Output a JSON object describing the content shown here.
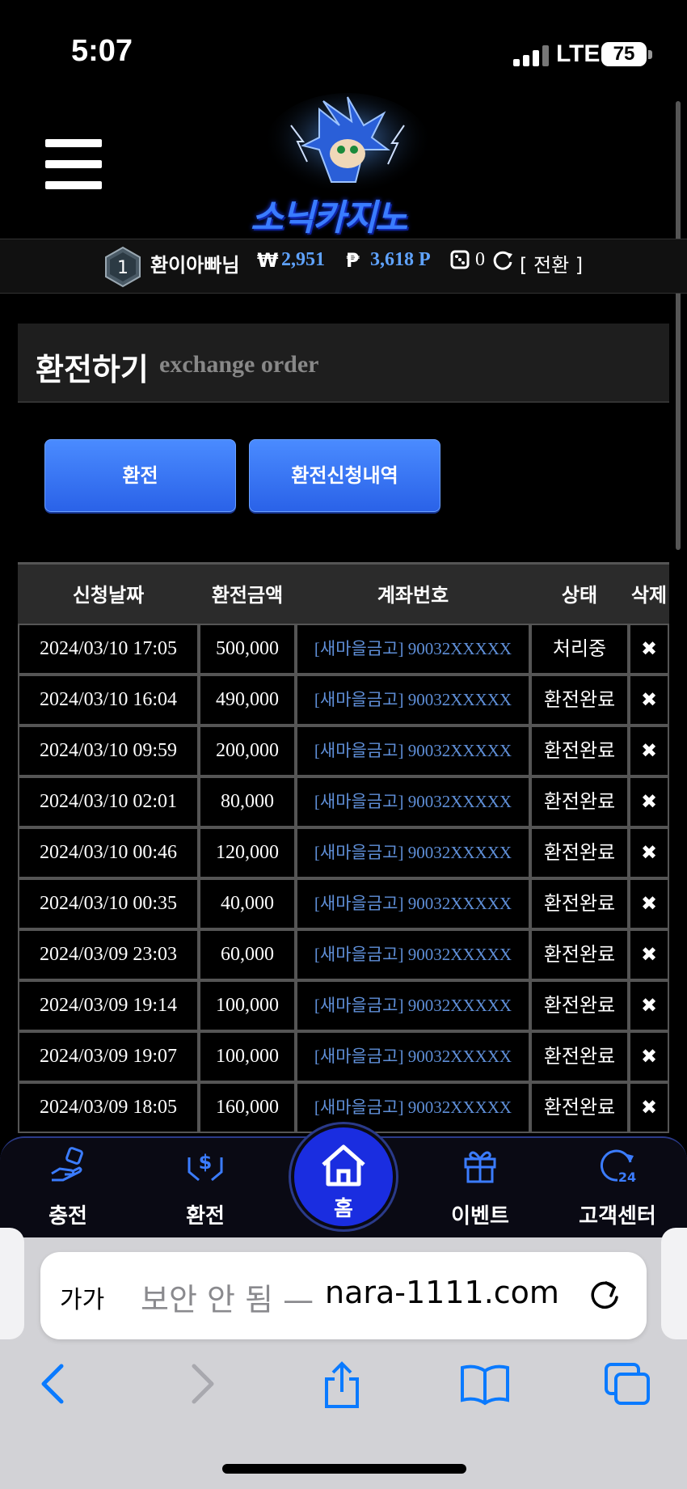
{
  "status_bar": {
    "time": "5:07",
    "network": "LTE",
    "battery": "75"
  },
  "header": {
    "logo_text": "소닉카지노"
  },
  "user": {
    "level": "1",
    "name": "환이아빠님",
    "won_symbol": "₩",
    "money": "2,951",
    "point_symbol": "₱",
    "points": "3,618 P",
    "chips": "0",
    "convert_label": "[ 전환 ]"
  },
  "section": {
    "title_ko": "환전하기",
    "title_en": "exchange order"
  },
  "tabs": [
    {
      "label": "환전"
    },
    {
      "label": "환전신청내역"
    }
  ],
  "table": {
    "headers": [
      "신청날짜",
      "환전금액",
      "계좌번호",
      "상태",
      "삭제"
    ],
    "rows": [
      {
        "date": "2024/03/10 17:05",
        "amount": "500,000",
        "account": "[새마을금고] 90032XXXXX",
        "status": "처리중"
      },
      {
        "date": "2024/03/10 16:04",
        "amount": "490,000",
        "account": "[새마을금고] 90032XXXXX",
        "status": "환전완료"
      },
      {
        "date": "2024/03/10 09:59",
        "amount": "200,000",
        "account": "[새마을금고] 90032XXXXX",
        "status": "환전완료"
      },
      {
        "date": "2024/03/10 02:01",
        "amount": "80,000",
        "account": "[새마을금고] 90032XXXXX",
        "status": "환전완료"
      },
      {
        "date": "2024/03/10 00:46",
        "amount": "120,000",
        "account": "[새마을금고] 90032XXXXX",
        "status": "환전완료"
      },
      {
        "date": "2024/03/10 00:35",
        "amount": "40,000",
        "account": "[새마을금고] 90032XXXXX",
        "status": "환전완료"
      },
      {
        "date": "2024/03/09 23:03",
        "amount": "60,000",
        "account": "[새마을금고] 90032XXXXX",
        "status": "환전완료"
      },
      {
        "date": "2024/03/09 19:14",
        "amount": "100,000",
        "account": "[새마을금고] 90032XXXXX",
        "status": "환전완료"
      },
      {
        "date": "2024/03/09 19:07",
        "amount": "100,000",
        "account": "[새마을금고] 90032XXXXX",
        "status": "환전완료"
      },
      {
        "date": "2024/03/09 18:05",
        "amount": "160,000",
        "account": "[새마을금고] 90032XXXXX",
        "status": "환전완료"
      }
    ],
    "delete_glyph": "✖"
  },
  "bottom_nav": {
    "items": [
      {
        "label": "충전",
        "icon": "hand-money-icon"
      },
      {
        "label": "환전",
        "icon": "hands-dollar-icon"
      },
      {
        "label": "홈",
        "icon": "home-icon"
      },
      {
        "label": "이벤트",
        "icon": "gift-icon"
      },
      {
        "label": "고객센터",
        "icon": "24h-support-icon"
      }
    ],
    "accent": "#1a2de0"
  },
  "browser": {
    "text_size_label": "가가",
    "insecure_label": "보안 안 됨 —",
    "domain": "nara-1111.com"
  },
  "colors": {
    "link_blue": "#5fa3ff",
    "button_blue": "#3a75f5",
    "ios_blue": "#0a7aff"
  }
}
